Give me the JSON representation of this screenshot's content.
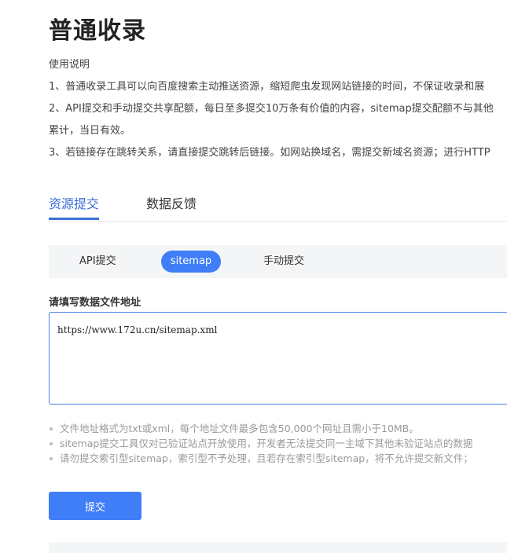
{
  "page": {
    "title": "普通收录"
  },
  "usage": {
    "heading": "使用说明",
    "lines": [
      "1、普通收录工具可以向百度搜索主动推送资源，缩短爬虫发现网站链接的时间，不保证收录和展",
      "2、API提交和手动提交共享配额，每日至多提交10万条有价值的内容，sitemap提交配额不与其他",
      "累计，当日有效。",
      "3、若链接存在跳转关系，请直接提交跳转后链接。如网站换域名，需提交新域名资源；进行HTTP"
    ]
  },
  "tabs": [
    {
      "label": "资源提交",
      "active": true
    },
    {
      "label": "数据反馈",
      "active": false
    }
  ],
  "subtabs": [
    {
      "label": "API提交",
      "active": false
    },
    {
      "label": "sitemap",
      "active": true
    },
    {
      "label": "手动提交",
      "active": false
    }
  ],
  "form": {
    "label": "请填写数据文件地址",
    "value": "https://www.172u.cn/sitemap.xml"
  },
  "tips": [
    "文件地址格式为txt或xml，每个地址文件最多包含50,000个网址且需小于10MB。",
    "sitemap提交工具仅对已验证站点开放使用，开发者无法提交同一主域下其他未验证站点的数据",
    "请勿提交索引型sitemap，索引型不予处理，且若存在索引型sitemap，将不允许提交新文件；"
  ],
  "submit": {
    "label": "提交"
  },
  "colors": {
    "accent": "#3f7ef7",
    "tab_active": "#3a6fd8"
  }
}
